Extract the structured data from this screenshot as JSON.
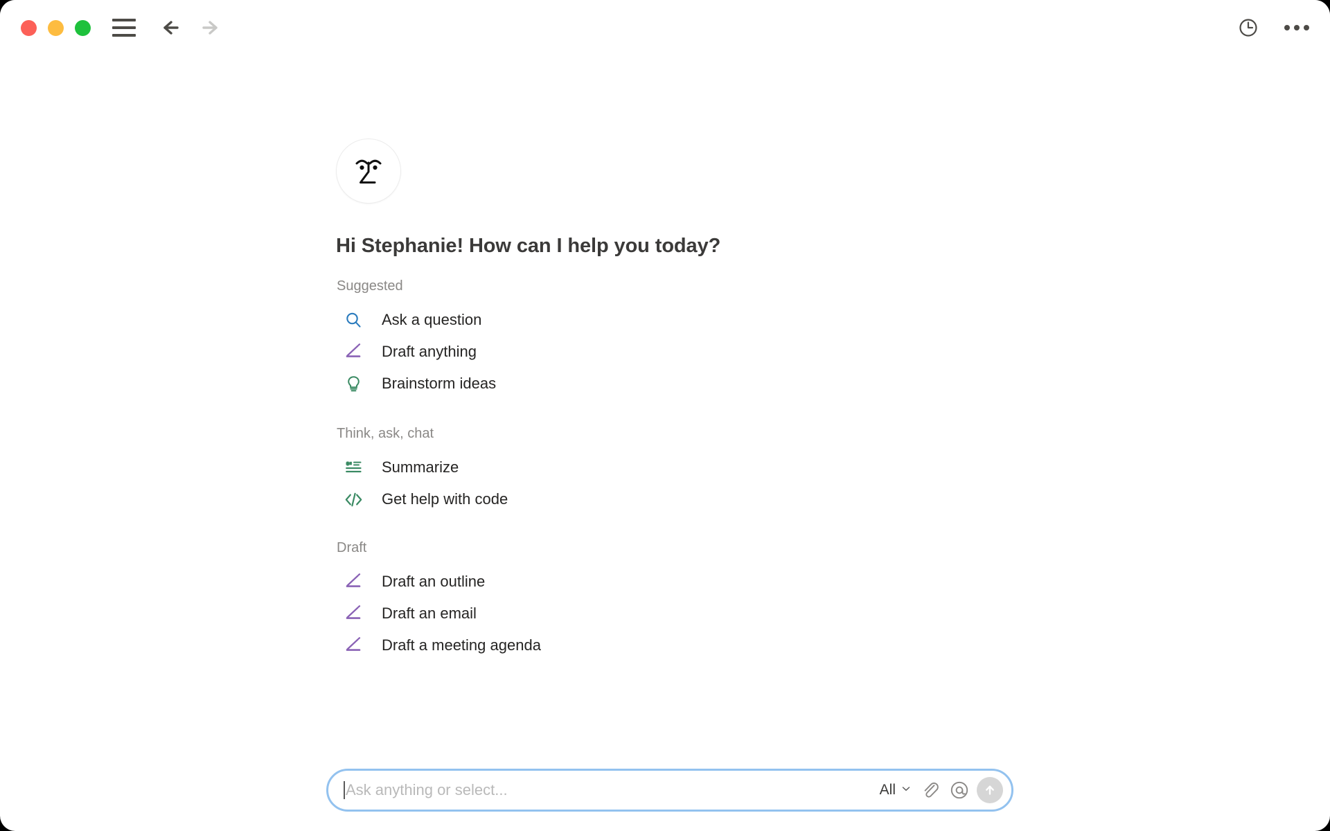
{
  "window": {
    "traffic_lights": {
      "close_color": "#fc6058",
      "minimize_color": "#fdbc40",
      "maximize_color": "#1ec13c"
    },
    "menu_icon": "hamburger-menu-icon",
    "back_icon": "back-arrow-icon",
    "forward_icon": "forward-arrow-icon",
    "history_icon": "clock-history-icon",
    "more_icon": "more-options-icon"
  },
  "brand": {
    "avatar_icon": "copilot-face-avatar-icon"
  },
  "greeting": "Hi Stephanie! How can I help you today?",
  "groups": [
    {
      "title": "Suggested",
      "items": [
        {
          "label": "Ask a question",
          "icon": "search-icon",
          "color": "#2a7bbd"
        },
        {
          "label": "Draft anything",
          "icon": "pencil-icon",
          "color": "#8a62b5"
        },
        {
          "label": "Brainstorm ideas",
          "icon": "lightbulb-icon",
          "color": "#3a8a63"
        }
      ]
    },
    {
      "title": "Think, ask, chat",
      "items": [
        {
          "label": "Summarize",
          "icon": "summarize-icon",
          "color": "#3a8a63"
        },
        {
          "label": "Get help with code",
          "icon": "code-icon",
          "color": "#3a8a63"
        }
      ]
    },
    {
      "title": "Draft",
      "items": [
        {
          "label": "Draft an outline",
          "icon": "pencil-icon",
          "color": "#8a62b5"
        },
        {
          "label": "Draft an email",
          "icon": "pencil-icon",
          "color": "#8a62b5"
        },
        {
          "label": "Draft a meeting agenda",
          "icon": "pencil-icon",
          "color": "#8a62b5"
        }
      ]
    }
  ],
  "composer": {
    "placeholder": "Ask anything or select...",
    "value": "",
    "scope_label": "All",
    "scope_chevron_icon": "chevron-down-icon",
    "attach_icon": "paperclip-icon",
    "mention_icon": "at-mention-icon",
    "send_icon": "send-arrow-up-icon",
    "border_color": "#93c2ef",
    "send_button_color": "#d6d6d6"
  }
}
